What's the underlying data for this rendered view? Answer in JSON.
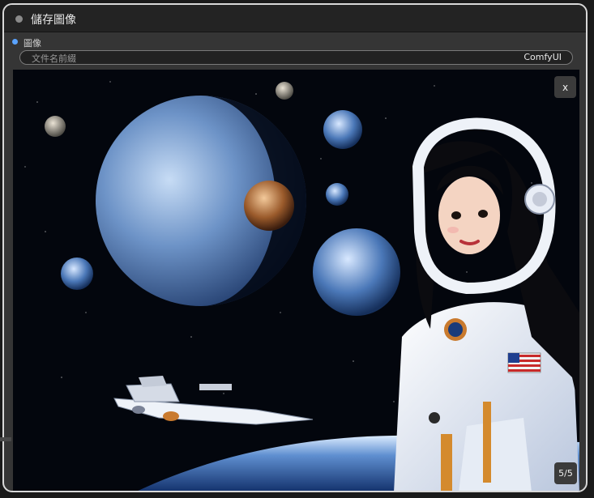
{
  "node": {
    "title": "儲存圖像",
    "output_label": "圖像",
    "filename_prefix": {
      "label": "文件名前綴",
      "value": "ComfyUI"
    }
  },
  "preview": {
    "close_label": "x",
    "counter": "5/5",
    "image_index": 5,
    "image_count": 5
  }
}
